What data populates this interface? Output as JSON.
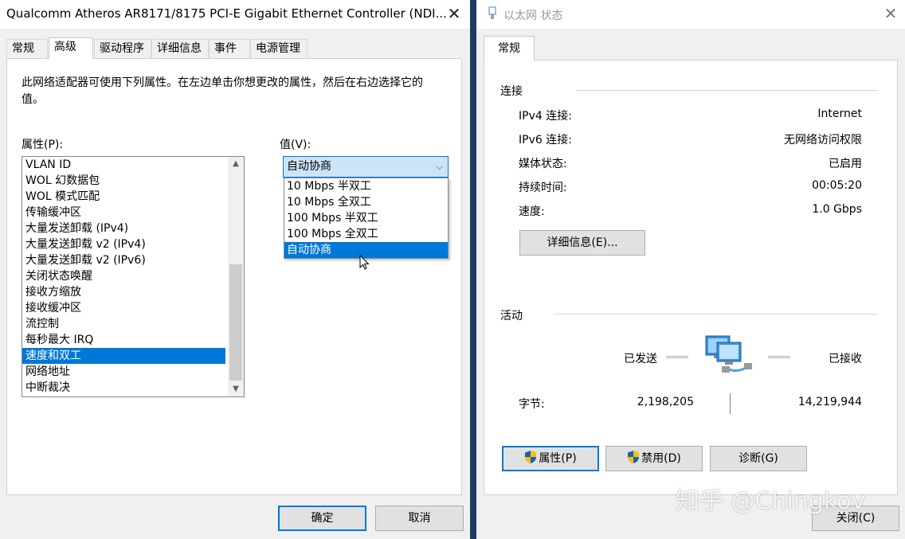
{
  "left_window": {
    "title": "Qualcomm Atheros AR8171/8175 PCI-E Gigabit Ethernet Controller (NDI...",
    "tabs": [
      "常规",
      "高级",
      "驱动程序",
      "详细信息",
      "事件",
      "电源管理"
    ],
    "description": "此网络适配器可使用下列属性。在左边单击你想更改的属性，然后在右边选择它的值。",
    "property_label": "属性(P):",
    "value_label": "值(V):",
    "properties": [
      "VLAN ID",
      "WOL 幻数据包",
      "WOL 模式匹配",
      "传输缓冲区",
      "大量发送卸载 (IPv4)",
      "大量发送卸载 v2 (IPv4)",
      "大量发送卸载 v2 (IPv6)",
      "关闭状态唤醒",
      "接收方缩放",
      "接收缓冲区",
      "流控制",
      "每秒最大 IRQ",
      "速度和双工",
      "网络地址",
      "中断裁决"
    ],
    "selected_property": "速度和双工",
    "combo_value": "自动协商",
    "dropdown_options": [
      "10 Mbps 半双工",
      "10 Mbps 全双工",
      "100 Mbps 半双工",
      "100 Mbps 全双工",
      "自动协商"
    ],
    "selected_option": "自动协商",
    "ok_label": "确定",
    "cancel_label": "取消"
  },
  "right_window": {
    "title": "以太网 状态",
    "tab": "常规",
    "connection_group": "连接",
    "connection_rows": [
      {
        "label": "IPv4 连接:",
        "value": "Internet"
      },
      {
        "label": "IPv6 连接:",
        "value": "无网络访问权限"
      },
      {
        "label": "媒体状态:",
        "value": "已启用"
      },
      {
        "label": "持续时间:",
        "value": "00:05:20"
      },
      {
        "label": "速度:",
        "value": "1.0 Gbps"
      }
    ],
    "details_button": "详细信息(E)...",
    "activity_group": "活动",
    "sent_label": "已发送",
    "received_label": "已接收",
    "bytes_label": "字节:",
    "bytes_sent": "2,198,205",
    "bytes_received": "14,219,944",
    "properties_button": "属性(P)",
    "disable_button": "禁用(D)",
    "diagnose_button": "诊断(G)",
    "close_button": "关闭(C)"
  },
  "watermark": "知乎 @Chingkov",
  "colors": {
    "selection": "#0078d7",
    "combo_bg": "#cce4f7",
    "divider": "#1f3a5e"
  }
}
